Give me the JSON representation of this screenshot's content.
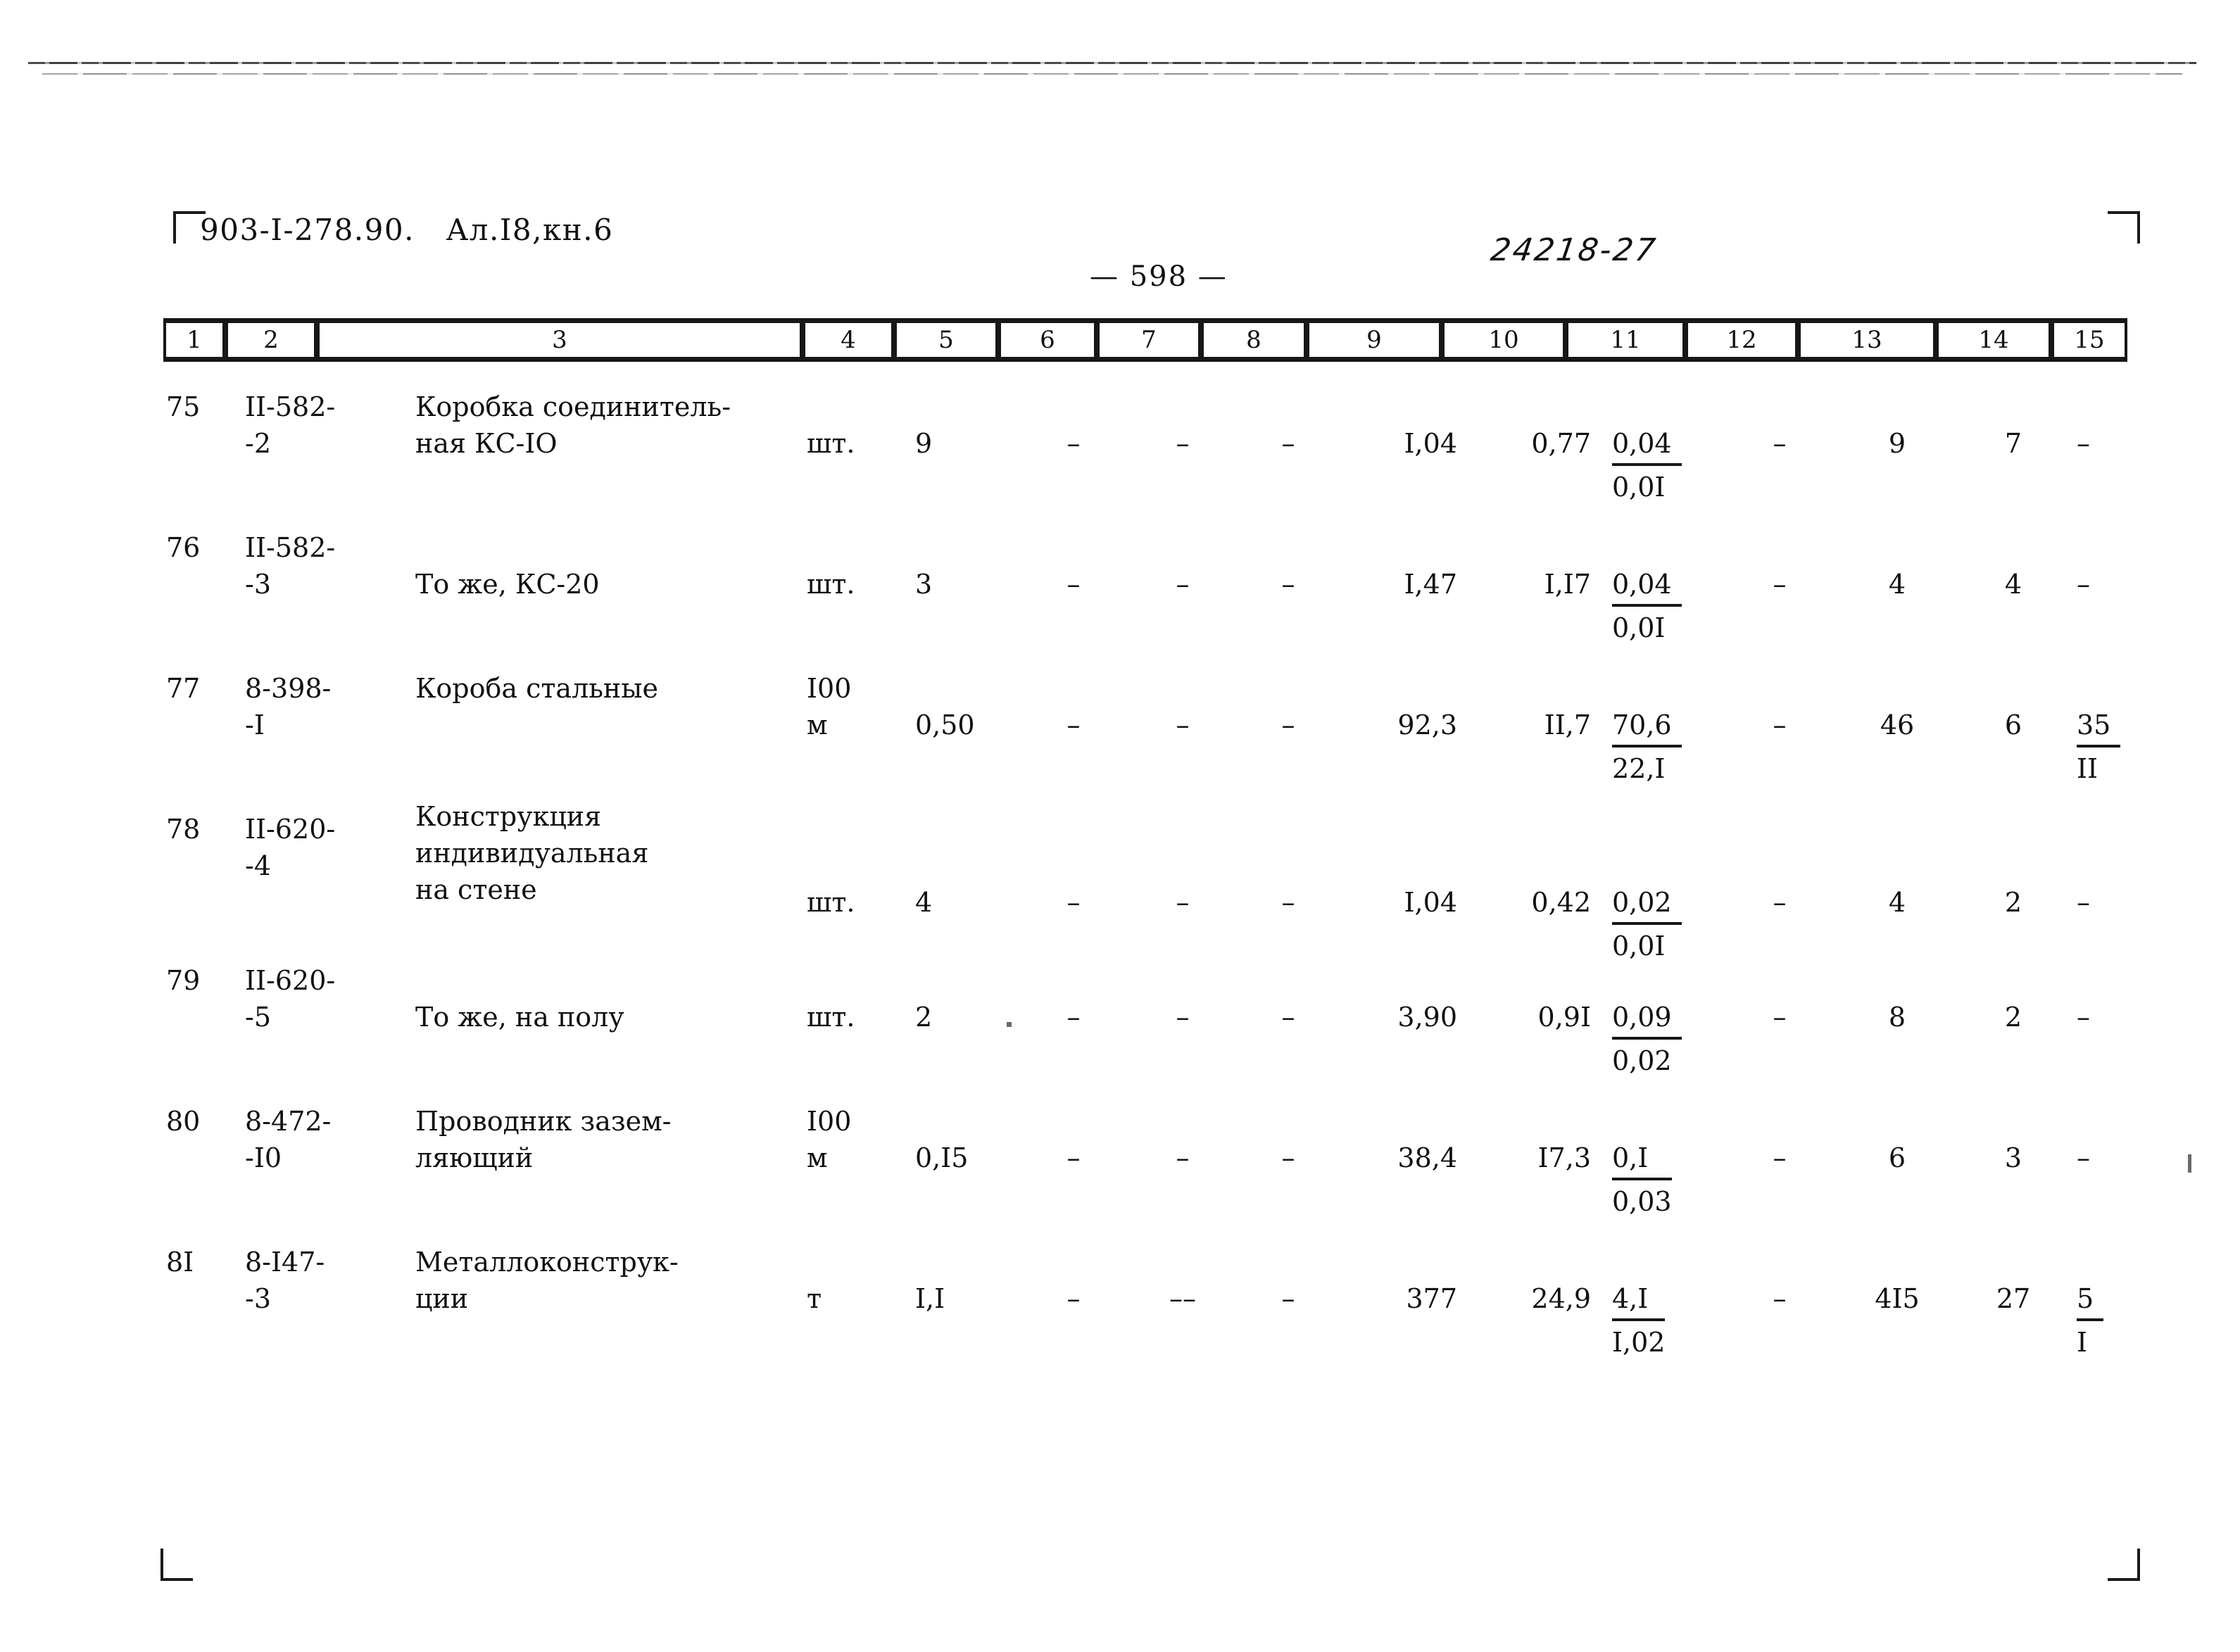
{
  "header": {
    "doc_code": "903-I-278.90.   Ал.I8,кн.6",
    "archive_stamp": "24218-27",
    "page_number": "— 598 —"
  },
  "table": {
    "column_numbers": [
      "1",
      "2",
      "3",
      "4",
      "5",
      "6",
      "7",
      "8",
      "9",
      "10",
      "11",
      "12",
      "13",
      "14",
      "15"
    ],
    "rows": [
      {
        "num": "75",
        "code_line1": "II-582-",
        "code_line2": "-2",
        "name_line1": "Коробка соединитель-",
        "name_line2": "ная КС-IO",
        "name_line3": "",
        "unit_line1": "",
        "unit_line2": "шт.",
        "qty": "9",
        "c6": "–",
        "c7": "–",
        "c8": "–",
        "c9": "I,04",
        "c10": "0,77",
        "c11_top": "0,04",
        "c11_bot": "0,0I",
        "c12": "–",
        "c13": "9",
        "c14": "7",
        "c15_top": "–",
        "c15_bot": ""
      },
      {
        "num": "76",
        "code_line1": "II-582-",
        "code_line2": "-3",
        "name_line1": "",
        "name_line2": "То же, КС-20",
        "name_line3": "",
        "unit_line1": "",
        "unit_line2": "шт.",
        "qty": "3",
        "c6": "–",
        "c7": "–",
        "c8": "–",
        "c9": "I,47",
        "c10": "I,I7",
        "c11_top": "0,04",
        "c11_bot": "0,0I",
        "c12": "–",
        "c13": "4",
        "c14": "4",
        "c15_top": "–",
        "c15_bot": ""
      },
      {
        "num": "77",
        "code_line1": "8-398-",
        "code_line2": "-I",
        "name_line1": "Короба стальные",
        "name_line2": "",
        "name_line3": "",
        "unit_line1": "I00",
        "unit_line2": "м",
        "qty": "0,50",
        "c6": "–",
        "c7": "–",
        "c8": "–",
        "c9": "92,3",
        "c10": "II,7",
        "c11_top": "70,6",
        "c11_bot": "22,I",
        "c12": "–",
        "c13": "46",
        "c14": "6",
        "c15_top": "35",
        "c15_bot": "II"
      },
      {
        "num": "78",
        "code_line1": "II-620-",
        "code_line2": "-4",
        "name_line1": "Конструкция",
        "name_line2": "индивидуальная",
        "name_line3": "на стене",
        "unit_line1": "",
        "unit_line2": "шт.",
        "qty": "4",
        "c6": "–",
        "c7": "–",
        "c8": "–",
        "c9": "I,04",
        "c10": "0,42",
        "c11_top": "0,02",
        "c11_bot": "0,0I",
        "c12": "–",
        "c13": "4",
        "c14": "2",
        "c15_top": "–",
        "c15_bot": ""
      },
      {
        "num": "79",
        "code_line1": "II-620-",
        "code_line2": "-5",
        "name_line1": "",
        "name_line2": "То же, на полу",
        "name_line3": "",
        "unit_line1": "",
        "unit_line2": "шт.",
        "qty": "2",
        "c6": "–",
        "c7": "–",
        "c8": "–",
        "c9": "3,90",
        "c10": "0,9I",
        "c11_top": "0,09",
        "c11_bot": "0,02",
        "c12": "–",
        "c13": "8",
        "c14": "2",
        "c15_top": "–",
        "c15_bot": ""
      },
      {
        "num": "80",
        "code_line1": "8-472-",
        "code_line2": "-I0",
        "name_line1": "Проводник зазем-",
        "name_line2": "ляющий",
        "name_line3": "",
        "unit_line1": "I00",
        "unit_line2": "м",
        "qty": "0,I5",
        "c6": "–",
        "c7": "–",
        "c8": "–",
        "c9": "38,4",
        "c10": "I7,3",
        "c11_top": "0,I",
        "c11_bot": "0,03",
        "c12": "–",
        "c13": "6",
        "c14": "3",
        "c15_top": "–",
        "c15_bot": ""
      },
      {
        "num": "8I",
        "code_line1": "8-I47-",
        "code_line2": "-3",
        "name_line1": "Металлоконструк-",
        "name_line2": "ции",
        "name_line3": "",
        "unit_line1": "",
        "unit_line2": "т",
        "qty": "I,I",
        "c6": "–",
        "c7": "––",
        "c8": "–",
        "c9": "377",
        "c10": "24,9",
        "c11_top": "4,I",
        "c11_bot": "I,02",
        "c12": "–",
        "c13": "4I5",
        "c14": "27",
        "c15_top": "5",
        "c15_bot": "I"
      }
    ]
  }
}
